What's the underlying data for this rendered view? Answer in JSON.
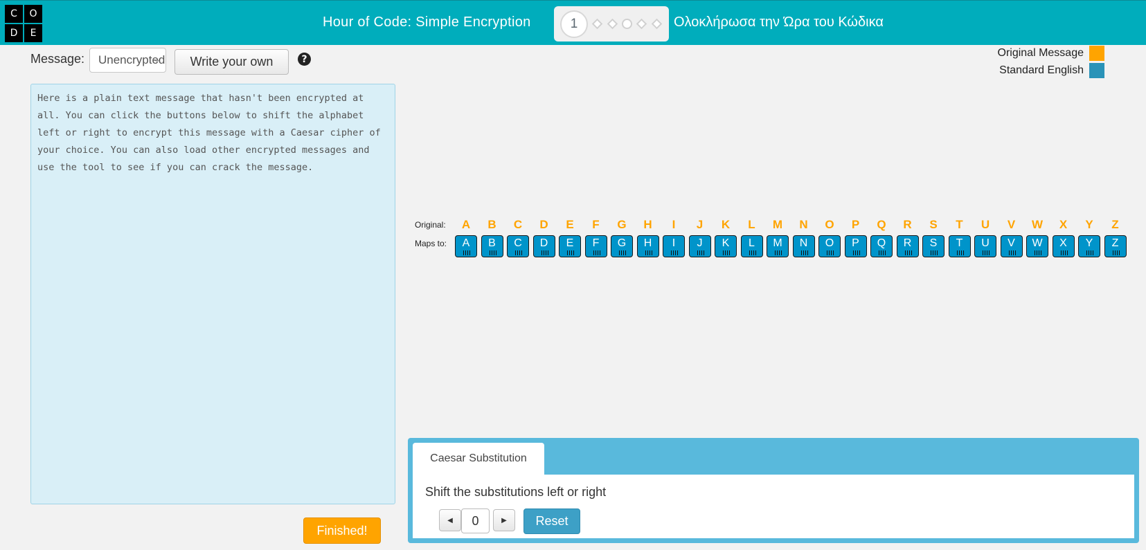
{
  "header": {
    "logo_letters": [
      "C",
      "O",
      "D",
      "E"
    ],
    "lesson_title": "Hour of Code: Simple Encryption",
    "level_number": "1",
    "finish_text": "Ολοκλήρωσα την Ώρα του Κώδικα",
    "progress_dots": [
      "diamond",
      "diamond",
      "circle",
      "diamond",
      "diamond"
    ]
  },
  "message_controls": {
    "label": "Message:",
    "select_value": "Unencrypted",
    "write_own_label": "Write your own",
    "help_icon": "question-circle-icon"
  },
  "message_text": "Here is a plain text message that hasn't been encrypted at all. You can click the buttons below to shift the alphabet left or right to encrypt this message with a Caesar cipher of your choice. You can also load other encrypted messages and use the tool to see if you can crack the message.",
  "legend": {
    "items": [
      {
        "label": "Original Message",
        "color": "#ffa400"
      },
      {
        "label": "Standard English",
        "color": "#2a93b8"
      }
    ]
  },
  "alphabet": {
    "original_label": "Original:",
    "maps_to_label": "Maps to:",
    "original": [
      "A",
      "B",
      "C",
      "D",
      "E",
      "F",
      "G",
      "H",
      "I",
      "J",
      "K",
      "L",
      "M",
      "N",
      "O",
      "P",
      "Q",
      "R",
      "S",
      "T",
      "U",
      "V",
      "W",
      "X",
      "Y",
      "Z"
    ],
    "mapped": [
      "A",
      "B",
      "C",
      "D",
      "E",
      "F",
      "G",
      "H",
      "I",
      "J",
      "K",
      "L",
      "M",
      "N",
      "O",
      "P",
      "Q",
      "R",
      "S",
      "T",
      "U",
      "V",
      "W",
      "X",
      "Y",
      "Z"
    ]
  },
  "caesar": {
    "tab_label": "Caesar Substitution",
    "description": "Shift the substitutions left or right",
    "shift_value": "0",
    "reset_label": "Reset",
    "left_icon": "caret-left-icon",
    "right_icon": "caret-right-icon"
  },
  "finished_label": "Finished!",
  "colors": {
    "header": "#00adbc",
    "original_letter": "#ffa400",
    "mapped_key": "#0094ca",
    "panel": "#59b9dc",
    "finished": "#ffa400"
  }
}
